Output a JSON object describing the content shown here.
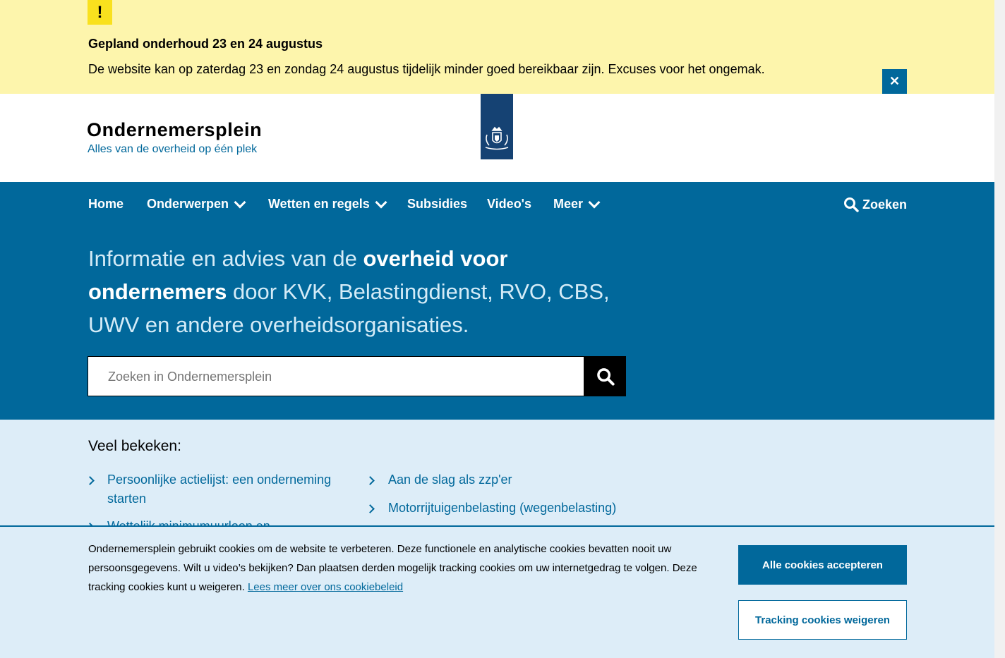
{
  "alert": {
    "badge": "!",
    "title": "Gepland onderhoud 23 en 24 augustus",
    "text": "De website kan op zaterdag 23 en zondag 24 augustus tijdelijk minder goed bereikbaar zijn. Excuses voor het ongemak.",
    "close_icon": "close-icon"
  },
  "brand": {
    "name": "Ondernemersplein",
    "tagline": "Alles van de overheid op één plek"
  },
  "nav": {
    "items": [
      {
        "label": "Home"
      },
      {
        "label": "Onderwerpen"
      },
      {
        "label": "Wetten en regels"
      },
      {
        "label": "Subsidies"
      },
      {
        "label": "Video's"
      },
      {
        "label": "Meer"
      }
    ],
    "search_label": "Zoeken"
  },
  "hero": {
    "part1": "Informatie en advies van de ",
    "bold1": "overheid voor ondernemers",
    "part2": " door KVK, Belastingdienst, RVO, CBS, UWV en andere overheidsorganisaties.",
    "search_placeholder": "Zoeken in Ondernemersplein"
  },
  "popular": {
    "heading": "Veel bekeken:",
    "links": [
      "Persoonlijke actielijst: een onderneming starten",
      "Aan de slag als zzp'er",
      "Motorrijtuigenbelasting (wegenbelasting)",
      "Wettelijk minimumuurloon en"
    ]
  },
  "cookie": {
    "text": "Ondernemersplein gebruikt cookies om de website te verbeteren. Deze functionele en analytische cookies bevatten nooit uw persoonsgegevens. Wilt u video’s bekijken? Dan plaatsen derden mogelijk tracking cookies om uw internetgedrag te volgen. Deze tracking cookies kunt u weigeren. ",
    "link": "Lees meer over ons cookiebeleid",
    "accept": "Alle cookies accepteren",
    "reject": "Tracking cookies weigeren"
  },
  "colors": {
    "primary": "#01689b",
    "alert_bg": "#fdf5ac",
    "light_bg": "#ddedf8",
    "logo_bg": "#154273"
  }
}
